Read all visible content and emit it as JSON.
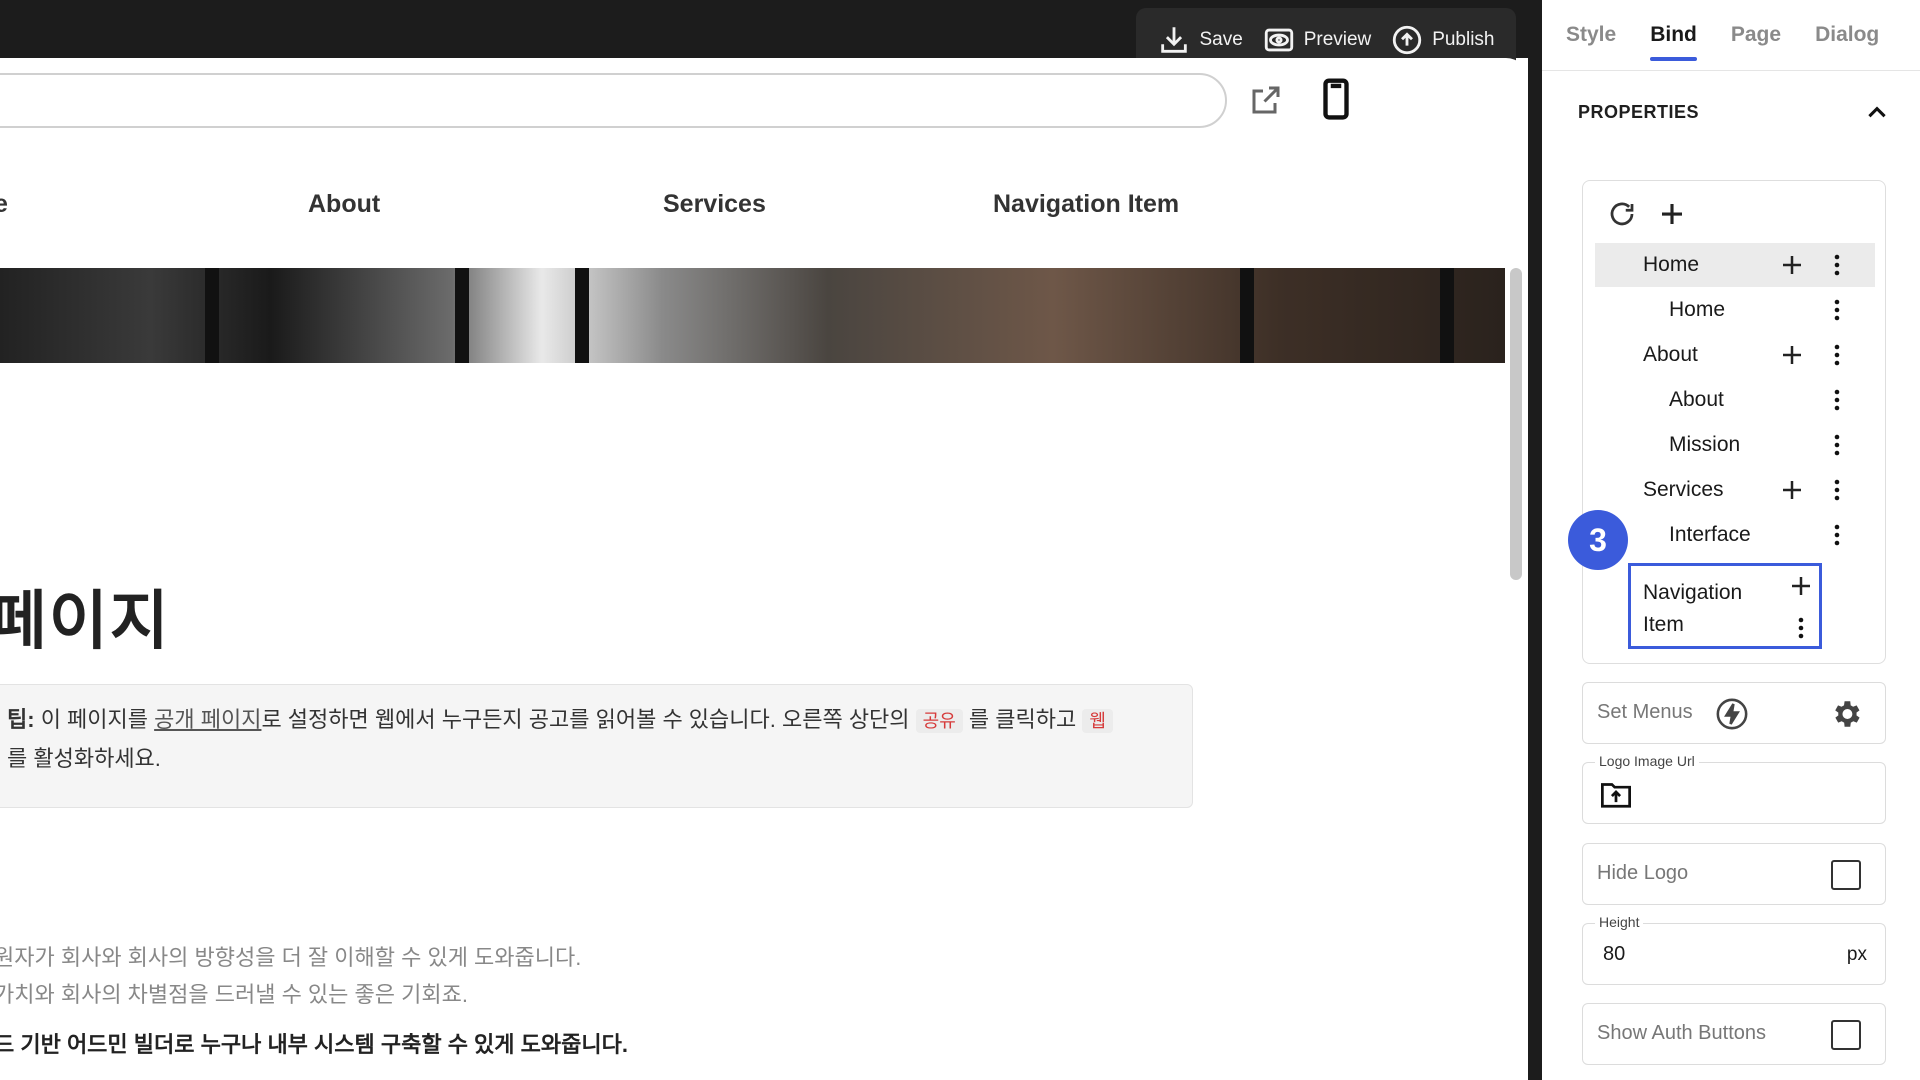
{
  "toolbar": {
    "save_label": "Save",
    "preview_label": "Preview",
    "publish_label": "Publish"
  },
  "site_nav": {
    "items": [
      "e",
      "About",
      "Services",
      "Navigation Item"
    ]
  },
  "page": {
    "heading": "페이지",
    "tip": {
      "prefix": "팁:",
      "text_1": " 이 페이지를 ",
      "link": "공개 페이지",
      "text_2": "로 설정하면 웹에서 누구든지 공고를 읽어볼 수 있습니다. 오른쪽 상단의 ",
      "code_1": "공유",
      "text_3": " 를 클릭하고 ",
      "code_2": "웹",
      "line_2": "를 활성화하세요."
    },
    "paragraphs": [
      "원자가 회사와 회사의 방향성을 더 잘 이해할 수 있게 도와줍니다.",
      "가치와 회사의 차별점을 드러낼 수 있는 좋은 기회죠.",
      "드 기반 어드민 빌더로 누구나 내부 시스템 구축할 수 있게 도와줍니다."
    ]
  },
  "panel": {
    "tabs": [
      "Style",
      "Bind",
      "Page",
      "Dialog"
    ],
    "active_tab": "Bind",
    "properties_title": "PROPERTIES",
    "menu_tree": [
      {
        "label": "Home",
        "level": 0,
        "has_add": true,
        "selected": true
      },
      {
        "label": "Home",
        "level": 1,
        "has_add": false
      },
      {
        "label": "About",
        "level": 0,
        "has_add": true
      },
      {
        "label": "About",
        "level": 1,
        "has_add": false
      },
      {
        "label": "Mission",
        "level": 1,
        "has_add": false
      },
      {
        "label": "Services",
        "level": 0,
        "has_add": true
      },
      {
        "label": "Interface",
        "level": 1,
        "has_add": false
      }
    ],
    "highlighted_node": {
      "line_1": "Navigation",
      "line_2": "Item"
    },
    "step_badge": "3",
    "set_menus_label": "Set Menus",
    "logo_url_label": "Logo Image Url",
    "hide_logo_label": "Hide Logo",
    "height_label": "Height",
    "height_value": "80",
    "height_unit": "px",
    "show_auth_label": "Show Auth Buttons"
  },
  "colors": {
    "accent": "#3b5bdb",
    "topbar": "#1c1c1c"
  }
}
